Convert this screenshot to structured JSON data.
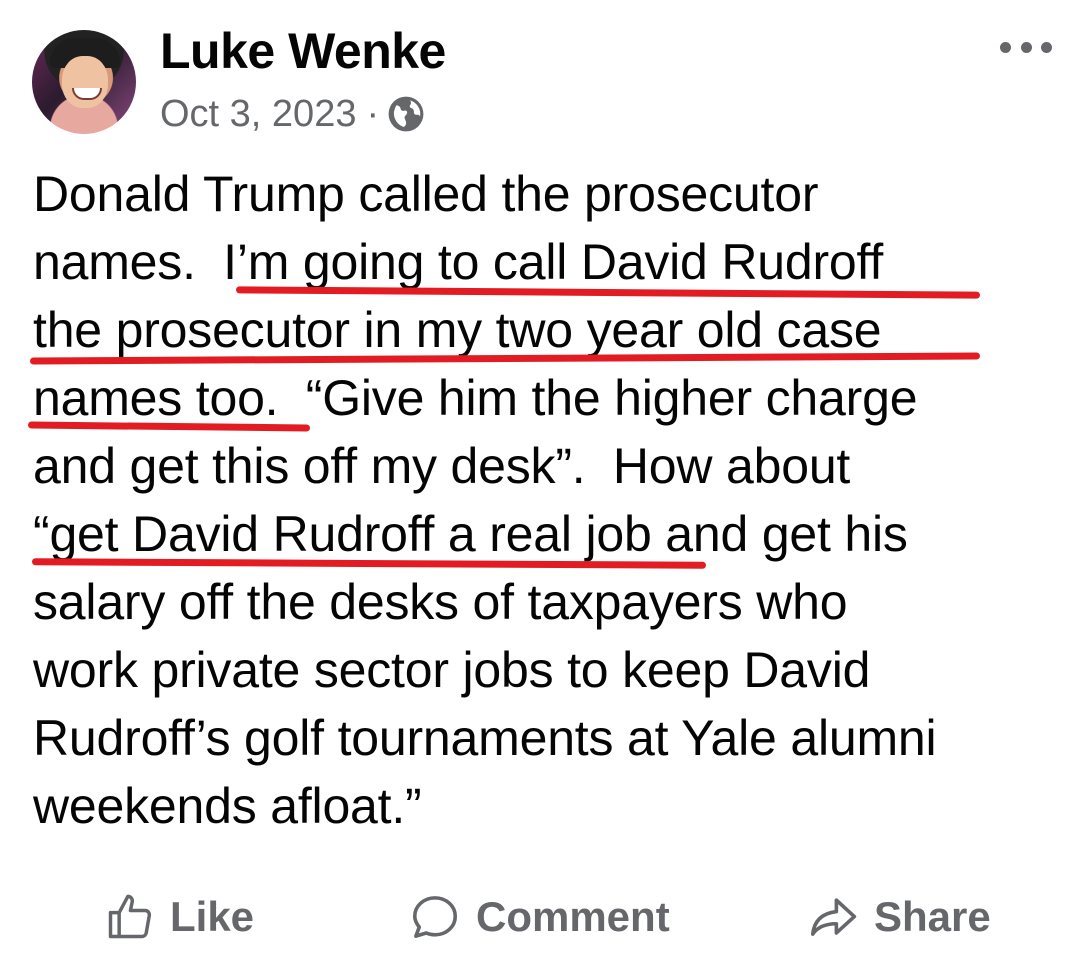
{
  "post": {
    "author": "Luke Wenke",
    "date": "Oct 3, 2023",
    "separator": "·",
    "audience_icon": "globe-icon",
    "more_icon": "more-options-icon",
    "body": "Donald Trump called the prosecutor\nnames.  I’m going to call David Rudroff\nthe prosecutor in my two year old case\nnames too.  “Give him the higher charge\nand get this off my desk”.  How about\n“get David Rudroff a real job and get his\nsalary off the desks of taxpayers who\nwork private sector jobs to keep David\nRudroff’s golf tournaments at Yale alumni\nweekends afloat.”",
    "underline_color": "#e31b23"
  },
  "actions": {
    "like": "Like",
    "comment": "Comment",
    "share": "Share"
  },
  "colors": {
    "text": "#050505",
    "secondary": "#65676b",
    "background": "#ffffff"
  }
}
